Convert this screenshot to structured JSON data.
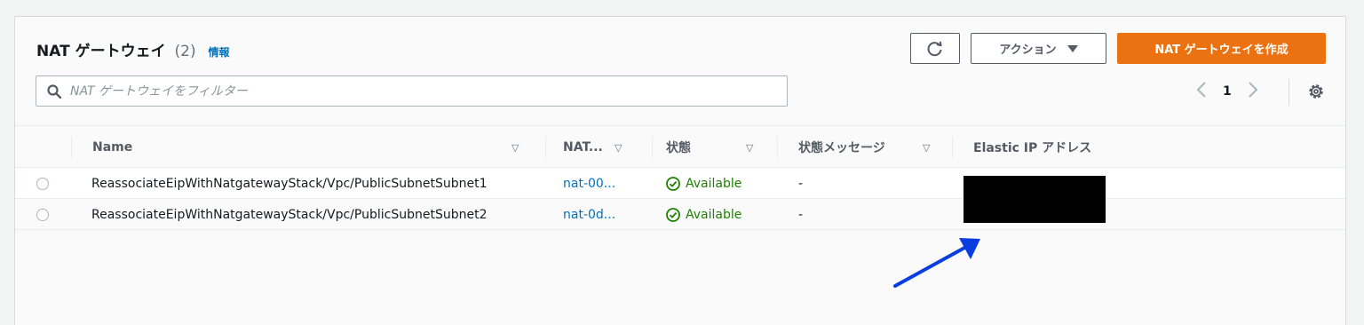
{
  "header": {
    "title": "NAT ゲートウェイ",
    "count": "(2)",
    "info_link": "情報"
  },
  "toolbar": {
    "refresh_label": "",
    "actions_label": "アクション",
    "create_label": "NAT ゲートウェイを作成"
  },
  "search": {
    "placeholder": "NAT ゲートウェイをフィルター",
    "value": ""
  },
  "pagination": {
    "current_page": "1"
  },
  "table": {
    "columns": [
      {
        "label": "Name"
      },
      {
        "label": "NAT..."
      },
      {
        "label": "状態"
      },
      {
        "label": "状態メッセージ"
      },
      {
        "label": "Elastic IP アドレス"
      }
    ],
    "rows": [
      {
        "name": "ReassociateEipWithNatgatewayStack/Vpc/PublicSubnetSubnet1",
        "nat_id": "nat-00...",
        "status": "Available",
        "status_message": "-"
      },
      {
        "name": "ReassociateEipWithNatgatewayStack/Vpc/PublicSubnetSubnet2",
        "nat_id": "nat-0d...",
        "status": "Available",
        "status_message": "-"
      }
    ]
  },
  "icons": {
    "refresh": "refresh-icon",
    "dropdown": "caret-down-icon",
    "search": "search-icon",
    "prev": "chevron-left-icon",
    "next": "chevron-right-icon",
    "settings": "gear-icon",
    "sort": "sort-icon",
    "status": "check-circle-icon",
    "annotation": "arrow-icon"
  },
  "colors": {
    "primary_button": "#ec7211",
    "link": "#0073bb",
    "status_available": "#1d8102",
    "annotation_arrow": "#0a3de0",
    "redaction": "#000000"
  }
}
